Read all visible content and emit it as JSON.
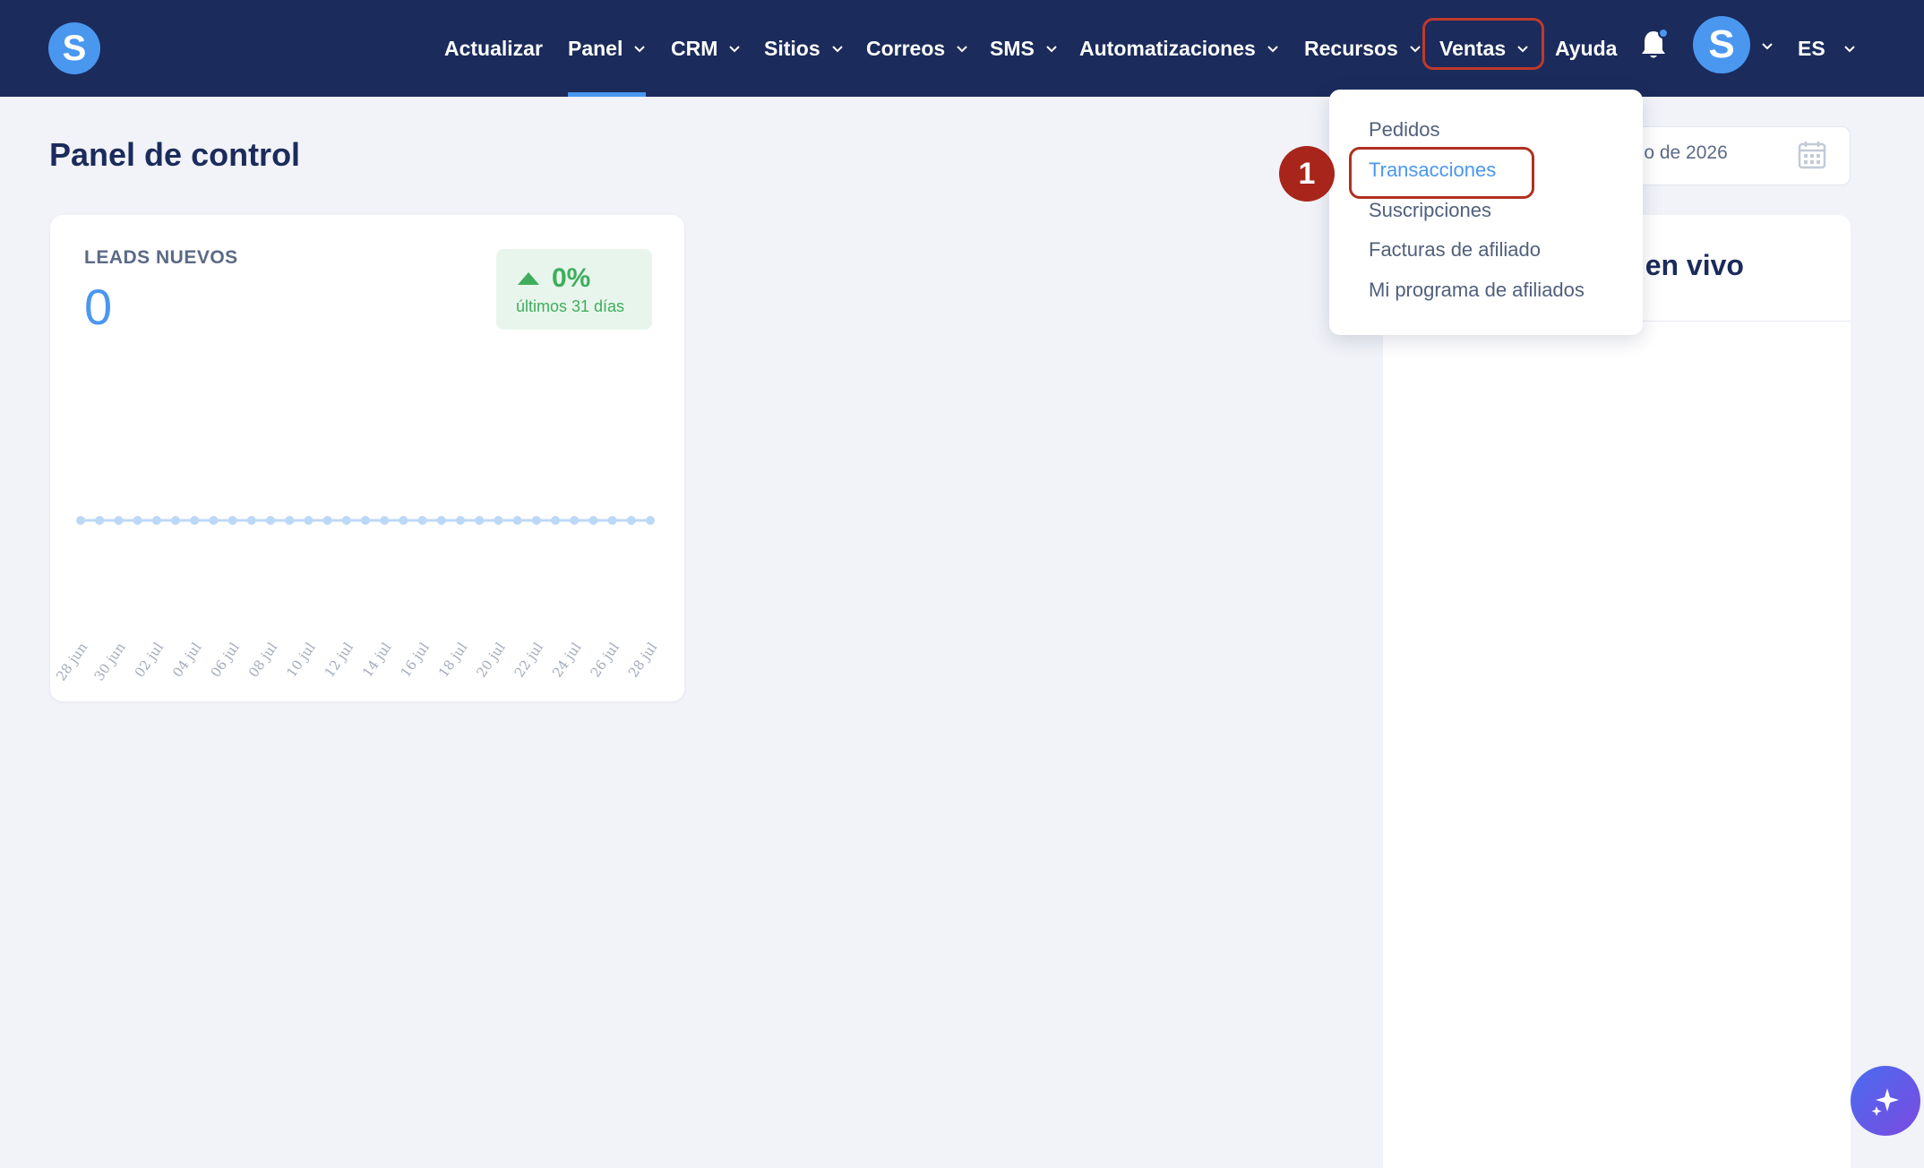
{
  "app": {
    "logo_letter": "S",
    "brand_color": "#4a97f0",
    "nav_bg": "#1b2b5b"
  },
  "nav": {
    "items": [
      {
        "label": "Actualizar",
        "has_chevron": false
      },
      {
        "label": "Panel",
        "has_chevron": true,
        "active": true
      },
      {
        "label": "CRM",
        "has_chevron": true
      },
      {
        "label": "Sitios",
        "has_chevron": true
      },
      {
        "label": "Correos",
        "has_chevron": true
      },
      {
        "label": "SMS",
        "has_chevron": true
      },
      {
        "label": "Automatizaciones",
        "has_chevron": true
      },
      {
        "label": "Recursos",
        "has_chevron": true
      },
      {
        "label": "Ventas",
        "has_chevron": true,
        "highlighted": true
      },
      {
        "label": "Ayuda",
        "has_chevron": false
      }
    ],
    "avatar_letter": "S",
    "language": "ES"
  },
  "dropdown": {
    "items": [
      "Pedidos",
      "Transacciones",
      "Suscripciones",
      "Facturas de afiliado",
      "Mi programa de afiliados"
    ],
    "highlighted_index": 1,
    "step_number": "1"
  },
  "page": {
    "title": "Panel de control"
  },
  "date_picker": {
    "text": "lio de 2026",
    "icon": "calendar-icon"
  },
  "live_panel": {
    "title": "s en vivo"
  },
  "leads_card": {
    "label": "LEADS NUEVOS",
    "value": "0",
    "change": "0%",
    "change_period": "últimos 31 días",
    "change_color": "#3fae5c"
  },
  "chart_data": {
    "type": "line",
    "x": [
      "28 jun",
      "29 jun",
      "30 jun",
      "01 jul",
      "02 jul",
      "03 jul",
      "04 jul",
      "05 jul",
      "06 jul",
      "07 jul",
      "08 jul",
      "09 jul",
      "10 jul",
      "11 jul",
      "12 jul",
      "13 jul",
      "14 jul",
      "15 jul",
      "16 jul",
      "17 jul",
      "18 jul",
      "19 jul",
      "20 jul",
      "21 jul",
      "22 jul",
      "23 jul",
      "24 jul",
      "25 jul",
      "26 jul",
      "27 jul",
      "28 jul"
    ],
    "tick_labels": [
      "28 jun",
      "30 jun",
      "02 jul",
      "04 jul",
      "06 jul",
      "08 jul",
      "10 jul",
      "12 jul",
      "14 jul",
      "16 jul",
      "18 jul",
      "20 jul",
      "22 jul",
      "24 jul",
      "26 jul",
      "28 jul"
    ],
    "series": [
      {
        "values": [
          0,
          0,
          0,
          0,
          0,
          0,
          0,
          0,
          0,
          0,
          0,
          0,
          0,
          0,
          0,
          0,
          0,
          0,
          0,
          0,
          0,
          0,
          0,
          0,
          0,
          0,
          0,
          0,
          0,
          0,
          0
        ]
      }
    ],
    "title": "",
    "xlabel": "",
    "ylabel": "",
    "grid": false,
    "color": "#bcd8f7"
  }
}
